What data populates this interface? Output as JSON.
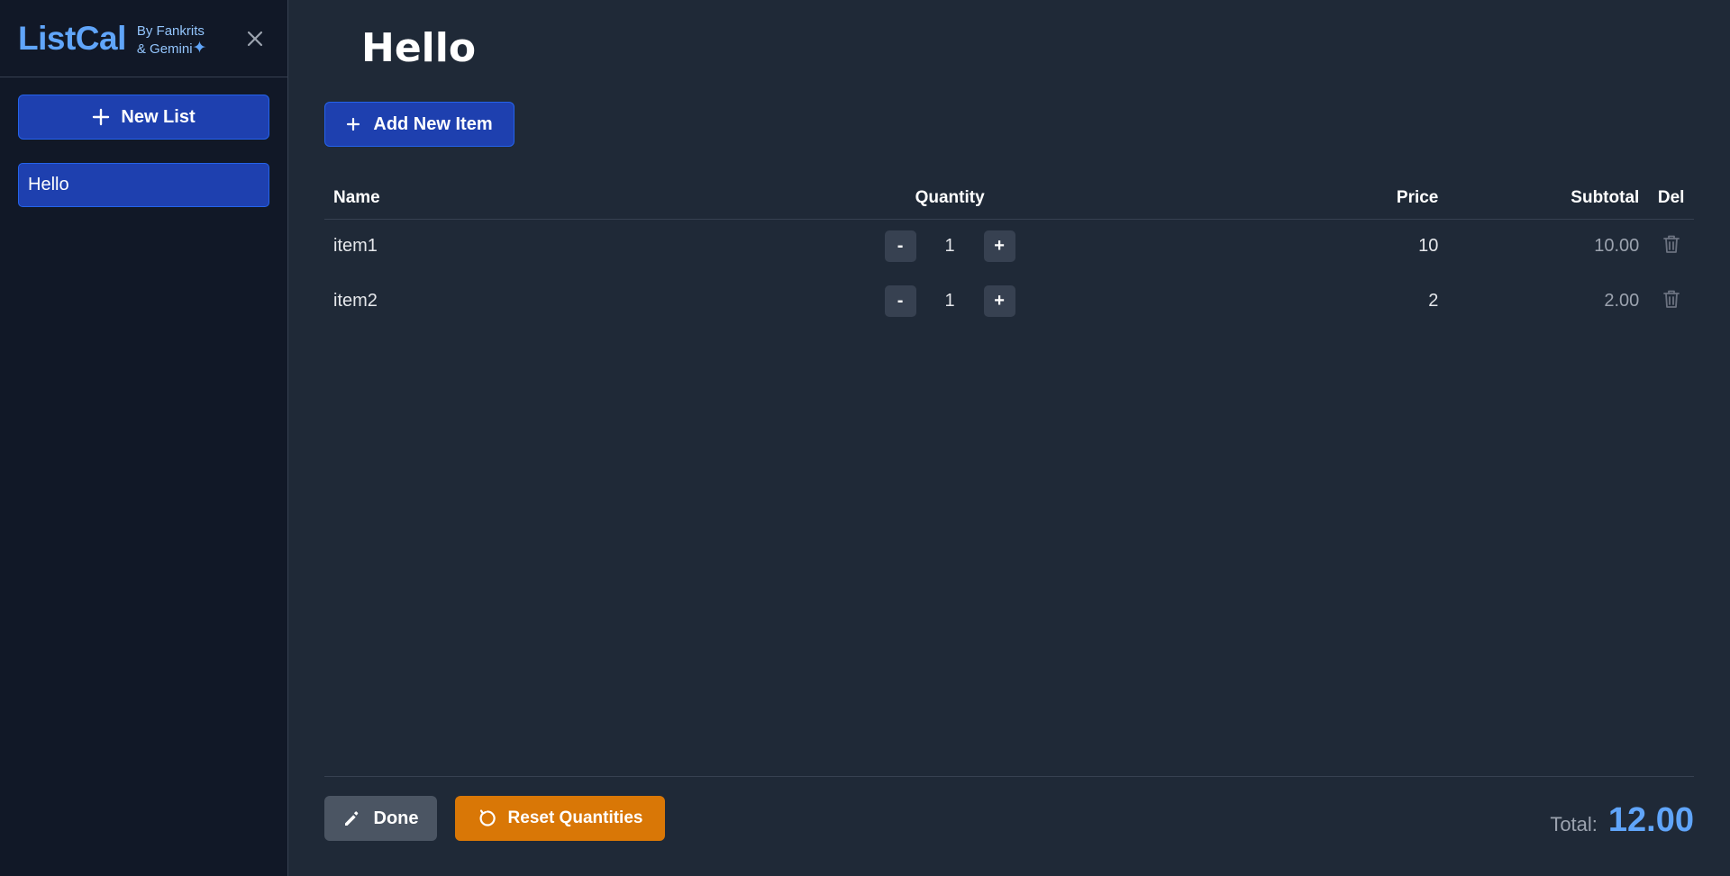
{
  "sidebar": {
    "brand_title": "ListCal",
    "brand_sub_line1": "By Fankrits",
    "brand_sub_line2": "& Gemini",
    "new_list_label": "New List",
    "lists": [
      {
        "label": "Hello",
        "active": true
      }
    ]
  },
  "main": {
    "title": "Hello",
    "add_item_label": "Add New Item",
    "columns": {
      "name": "Name",
      "quantity": "Quantity",
      "price": "Price",
      "subtotal": "Subtotal",
      "del": "Del"
    },
    "items": [
      {
        "name": "item1",
        "quantity": "1",
        "price": "10",
        "subtotal": "10.00",
        "minus": "-",
        "plus": "+"
      },
      {
        "name": "item2",
        "quantity": "1",
        "price": "2",
        "subtotal": "2.00",
        "minus": "-",
        "plus": "+"
      }
    ]
  },
  "footer": {
    "done_label": "Done",
    "reset_label": "Reset Quantities",
    "total_label": "Total:",
    "total_value": "12.00"
  },
  "colors": {
    "accent": "#60a5fa",
    "primary_button": "#1e40af",
    "reset_button": "#d97706",
    "done_button": "#4b5563",
    "background": "#1f2937",
    "sidebar_background": "#111827"
  }
}
